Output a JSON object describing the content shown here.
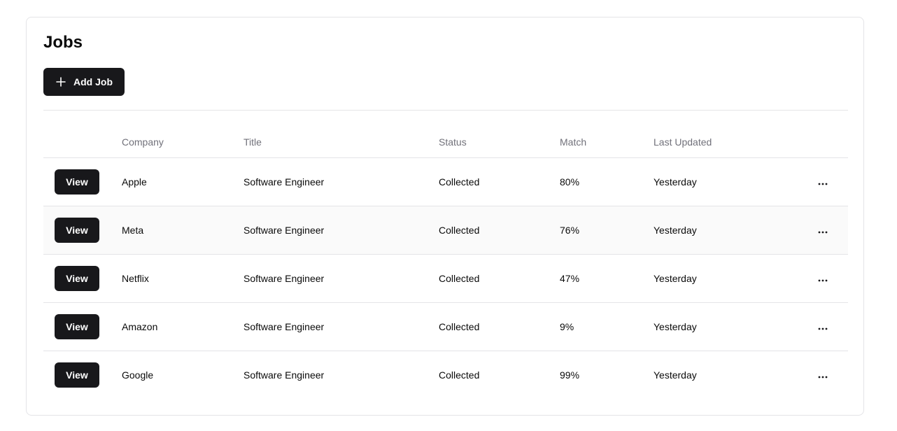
{
  "page": {
    "title": "Jobs",
    "add_button_label": "Add Job"
  },
  "table": {
    "columns": {
      "company": "Company",
      "title": "Title",
      "status": "Status",
      "match": "Match",
      "last_updated": "Last Updated"
    },
    "rows": [
      {
        "action": "View",
        "company": "Apple",
        "title": "Software Engineer",
        "status": "Collected",
        "match": "80%",
        "last_updated": "Yesterday"
      },
      {
        "action": "View",
        "company": "Meta",
        "title": "Software Engineer",
        "status": "Collected",
        "match": "76%",
        "last_updated": "Yesterday"
      },
      {
        "action": "View",
        "company": "Netflix",
        "title": "Software Engineer",
        "status": "Collected",
        "match": "47%",
        "last_updated": "Yesterday"
      },
      {
        "action": "View",
        "company": "Amazon",
        "title": "Software Engineer",
        "status": "Collected",
        "match": "9%",
        "last_updated": "Yesterday"
      },
      {
        "action": "View",
        "company": "Google",
        "title": "Software Engineer",
        "status": "Collected",
        "match": "99%",
        "last_updated": "Yesterday"
      }
    ]
  },
  "icons": {
    "add": "plus-icon",
    "row_menu": "more-horizontal-icon"
  },
  "colors": {
    "primary_button": "#18181b",
    "border": "#e4e4e7",
    "muted_text": "#71717a",
    "hover_row": "#fafafa"
  }
}
